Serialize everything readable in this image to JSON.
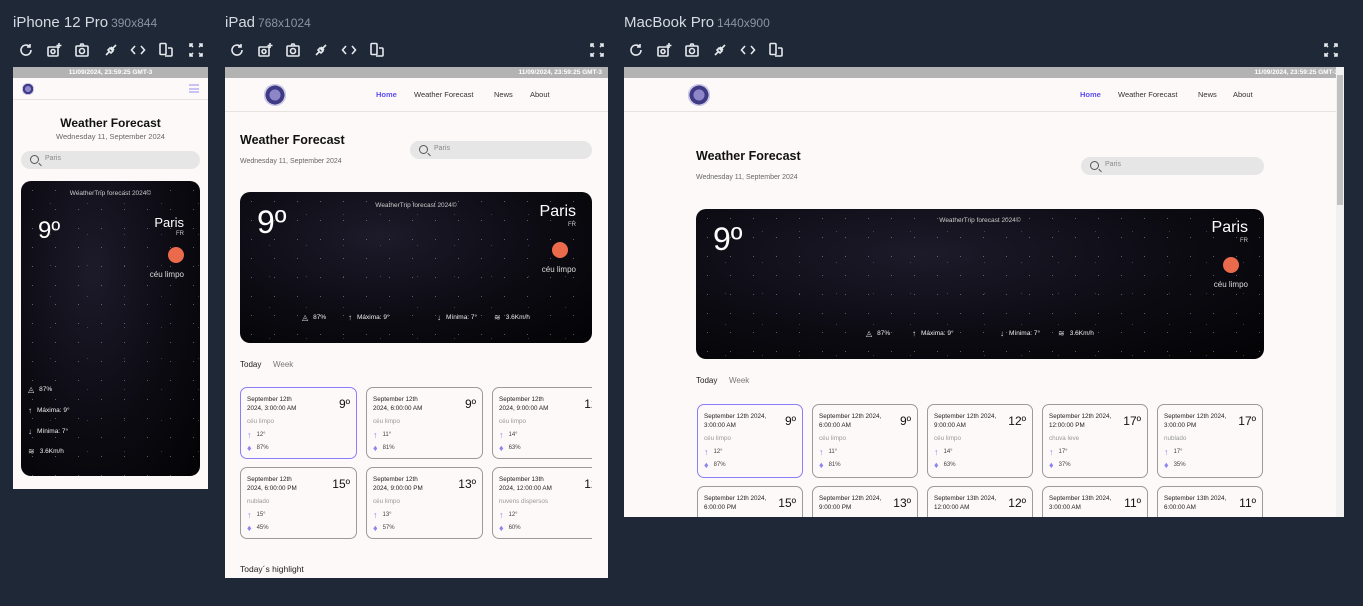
{
  "devices": [
    {
      "name": "iPhone 12 Pro",
      "size": "390x844"
    },
    {
      "name": "iPad",
      "size": "768x1024"
    },
    {
      "name": "MacBook Pro",
      "size": "1440x900"
    }
  ],
  "toolbar_icons": [
    "refresh-icon",
    "screenshot-add-icon",
    "camera-icon",
    "plug-icon",
    "code-icon",
    "rotate-device-icon",
    "fullscreen-icon"
  ],
  "site": {
    "status_time": "11/09/2024, 23:59:25 GMT-3",
    "nav": [
      "Home",
      "Weather Forecast",
      "News",
      "About"
    ],
    "title": "Weather Forecast",
    "date": "Wednesday 11, September 2024",
    "search_placeholder": "Paris",
    "hero": {
      "brand": "WeatherTrip forecast 2024©",
      "temp": "9º",
      "city": "Paris",
      "country": "FR",
      "condition": "céu limpo",
      "humidity": "87%",
      "max": "Máxima: 9°",
      "min": "Mínima: 7°",
      "wind": "3.6Km/h"
    },
    "tabs": [
      "Today",
      "Week"
    ],
    "cards": [
      {
        "date": "September 12th 2024, 3:00:00 AM",
        "temp": "9º",
        "cond": "céu limpo",
        "max": "12°",
        "hum": "87%"
      },
      {
        "date": "September 12th 2024, 6:00:00 AM",
        "temp": "9º",
        "cond": "céu limpo",
        "max": "11°",
        "hum": "81%"
      },
      {
        "date": "September 12th 2024, 9:00:00 AM",
        "temp": "12º",
        "cond": "céu limpo",
        "max": "14°",
        "hum": "63%"
      },
      {
        "date": "September 12th 2024, 12:00:00 PM",
        "temp": "17º",
        "cond": "chuva leve",
        "max": "17°",
        "hum": "37%"
      },
      {
        "date": "September 12th 2024, 3:00:00 PM",
        "temp": "17º",
        "cond": "nublado",
        "max": "17°",
        "hum": "35%"
      },
      {
        "date": "September 12th 2024, 6:00:00 PM",
        "temp": "15º",
        "cond": "nublado",
        "max": "15°",
        "hum": "45%"
      },
      {
        "date": "September 12th 2024, 9:00:00 PM",
        "temp": "13º",
        "cond": "céu limpo",
        "max": "13°",
        "hum": "57%"
      },
      {
        "date": "September 13th 2024, 12:00:00 AM",
        "temp": "12º",
        "cond": "nuvens dispersos",
        "max": "12°",
        "hum": "60%"
      },
      {
        "date": "September 13th 2024, 3:00:00 AM",
        "temp": "11º"
      },
      {
        "date": "September 13th 2024, 6:00:00 AM",
        "temp": "11º"
      }
    ],
    "highlight_title": "Today´s highlight"
  },
  "colors": {
    "accent": "#5b4ff5",
    "sun": "#ec6a4c",
    "background": "#1e2837",
    "card_selected": "#8a7ff7"
  }
}
